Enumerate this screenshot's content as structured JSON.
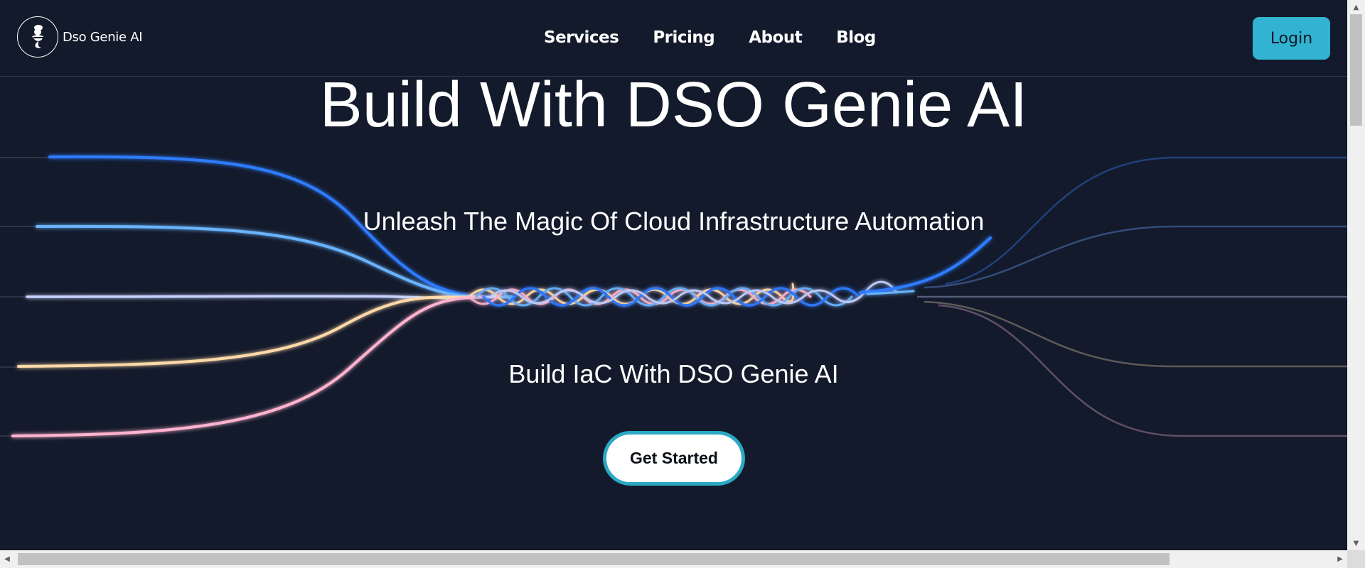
{
  "brand": {
    "name": "Dso Genie AI",
    "logo_icon": "genie-icon"
  },
  "nav": {
    "items": [
      {
        "label": "Services"
      },
      {
        "label": "Pricing"
      },
      {
        "label": "About"
      },
      {
        "label": "Blog"
      }
    ],
    "login_label": "Login"
  },
  "hero": {
    "title": "Build With DSO Genie AI",
    "subtitle": "Unleash The Magic Of Cloud Infrastructure Automation",
    "tagline": "Build IaC With DSO Genie AI",
    "cta_label": "Get Started"
  },
  "colors": {
    "background": "#131a2b",
    "accent": "#31b3d1",
    "wave_blue": "#2f7cff",
    "wave_light_blue": "#6ab4ff",
    "wave_lavender": "#b9c6ff",
    "wave_peach": "#ffd9a8",
    "wave_pink": "#ffb3cf"
  },
  "scrollbars": {
    "vertical_arrows": [
      "▲",
      "▼"
    ],
    "horizontal_arrows": [
      "◀",
      "▶"
    ]
  }
}
